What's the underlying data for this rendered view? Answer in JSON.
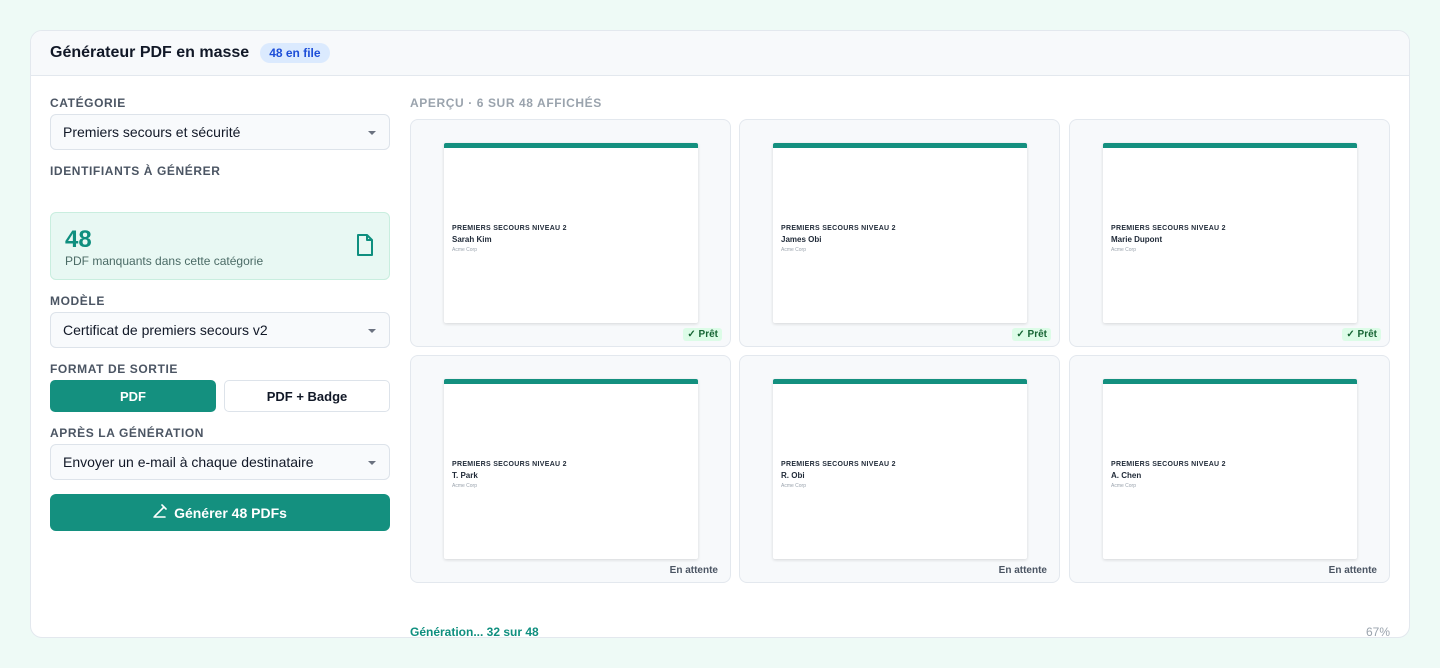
{
  "header": {
    "title": "Générateur PDF en masse",
    "queue_badge": "48 en file"
  },
  "form": {
    "category": {
      "label": "CATÉGORIE",
      "value": "Premiers secours et sécurité"
    },
    "identifiers": {
      "label": "IDENTIFIANTS À GÉNÉRER",
      "count": "48",
      "description": "PDF manquants dans cette catégorie",
      "icon": "file-icon"
    },
    "template": {
      "label": "MODÈLE",
      "value": "Certificat de premiers secours v2"
    },
    "output_format": {
      "label": "FORMAT DE SORTIE",
      "options": [
        "PDF",
        "PDF + Badge"
      ],
      "selected": "PDF"
    },
    "after_generation": {
      "label": "APRÈS LA GÉNÉRATION",
      "value": "Envoyer un e-mail à chaque destinataire"
    },
    "generate_button": {
      "label": "Générer 48 PDFs",
      "icon": "pen-icon"
    }
  },
  "preview": {
    "label": "APERÇU · 6 SUR 48 AFFICHÉS",
    "items": [
      {
        "course": "PREMIERS SECOURS NIVEAU 2",
        "name": "Sarah Kim",
        "org": "Acme Corp",
        "status": "✓ Prêt",
        "state": "ready"
      },
      {
        "course": "PREMIERS SECOURS NIVEAU 2",
        "name": "James Obi",
        "org": "Acme Corp",
        "status": "✓ Prêt",
        "state": "ready"
      },
      {
        "course": "PREMIERS SECOURS NIVEAU 2",
        "name": "Marie Dupont",
        "org": "Acme Corp",
        "status": "✓ Prêt",
        "state": "ready"
      },
      {
        "course": "PREMIERS SECOURS NIVEAU 2",
        "name": "T. Park",
        "org": "Acme Corp",
        "status": "En attente",
        "state": "waiting"
      },
      {
        "course": "PREMIERS SECOURS NIVEAU 2",
        "name": "R. Obi",
        "org": "Acme Corp",
        "status": "En attente",
        "state": "waiting"
      },
      {
        "course": "PREMIERS SECOURS NIVEAU 2",
        "name": "A. Chen",
        "org": "Acme Corp",
        "status": "En attente",
        "state": "waiting"
      }
    ]
  },
  "progress": {
    "label": "Génération... 32 sur 48",
    "percent_label": "67%",
    "fraction": 0.67
  },
  "colors": {
    "accent": "#14907f",
    "ready_bg": "#dcfce7",
    "badge_bg": "#dbeafe"
  }
}
